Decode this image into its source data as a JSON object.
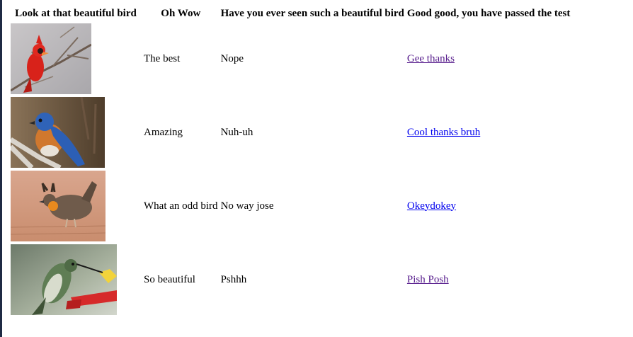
{
  "table": {
    "headers": [
      "Look at that beautiful bird",
      "Oh Wow",
      "Have you ever seen such a beautiful bird",
      "Good good, you have passed the test"
    ],
    "rows": [
      {
        "image": "cardinal-bird-image",
        "wow": "The best",
        "seen": "Nope",
        "link": "Gee thanks",
        "link_state": "visited"
      },
      {
        "image": "bluebird-image",
        "wow": "Amazing",
        "seen": "Nuh-uh",
        "link": "Cool thanks bruh",
        "link_state": "unvisited"
      },
      {
        "image": "prairie-chicken-image",
        "wow": "What an odd bird",
        "seen": "No way jose",
        "link": "Okeydokey",
        "link_state": "unvisited"
      },
      {
        "image": "hummingbird-image",
        "wow": "So beautiful",
        "seen": "Pshhh",
        "link": "Pish Posh",
        "link_state": "visited"
      }
    ]
  },
  "colors": {
    "visited_link": "#551a8b",
    "unvisited_link": "#0000ee",
    "left_border": "#1f2a44"
  }
}
